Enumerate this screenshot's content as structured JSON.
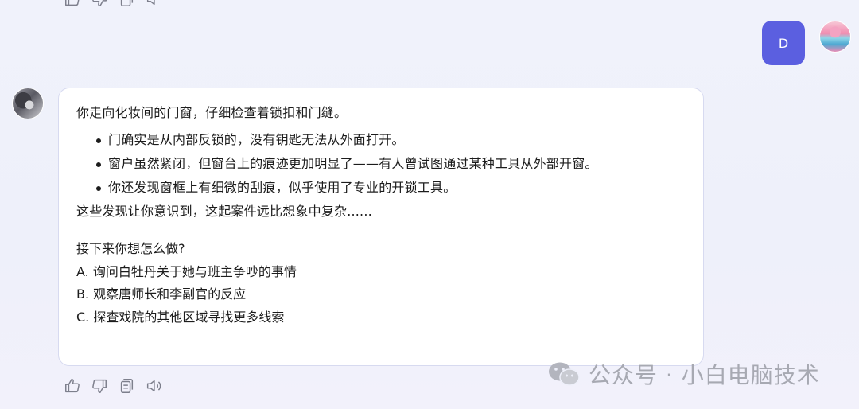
{
  "user_message": {
    "text": "D"
  },
  "bot_message": {
    "intro": "你走向化妆间的门窗，仔细检查着锁扣和门缝。",
    "findings": [
      "门确实是从内部反锁的，没有钥匙无法从外面打开。",
      "窗户虽然紧闭，但窗台上的痕迹更加明显了——有人曾试图通过某种工具从外部开窗。",
      "你还发现窗框上有细微的刮痕，似乎使用了专业的开锁工具。"
    ],
    "closing": "这些发现让你意识到，这起案件远比想象中复杂......",
    "prompt": "接下来你想怎么做?",
    "options": [
      "A. 询问白牡丹关于她与班主争吵的事情",
      "B. 观察唐师长和李副官的反应",
      "C. 探查戏院的其他区域寻找更多线索"
    ]
  },
  "actions": [
    "thumbs-up-icon",
    "thumbs-down-icon",
    "copy-icon",
    "speaker-icon"
  ],
  "watermark": {
    "text": "公众号 · 小白电脑技术"
  },
  "colors": {
    "user_bubble": "#5b5fe0",
    "bubble_border": "#d7daf0",
    "icon": "#7d7f8c"
  }
}
